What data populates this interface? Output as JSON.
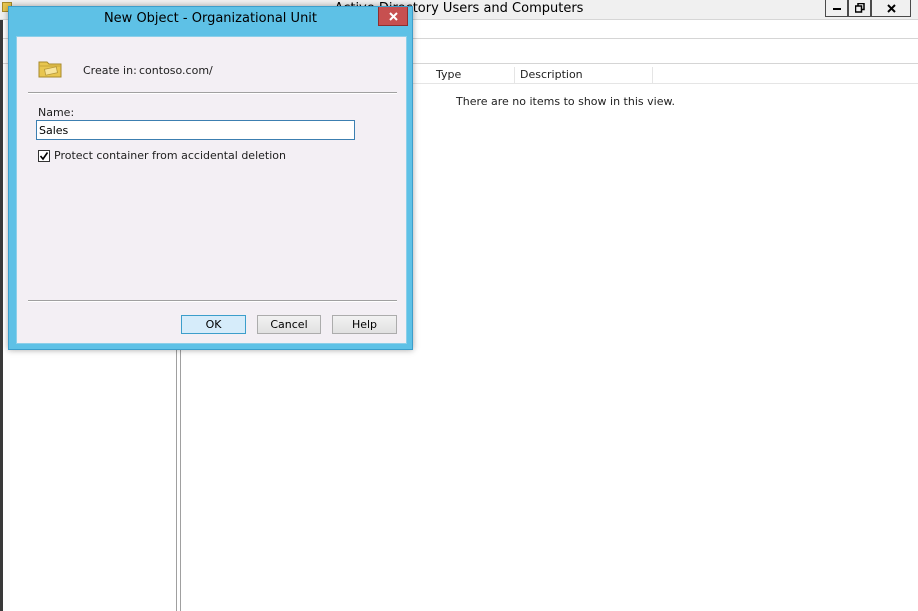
{
  "main_window": {
    "title": "Active Directory Users and Computers",
    "list": {
      "columns": [
        "Type",
        "Description"
      ],
      "empty_message": "There are no items to show in this view."
    },
    "controls": {
      "minimize": "–",
      "restore": "⧉",
      "close": "x"
    }
  },
  "dialog": {
    "title": "New Object - Organizational Unit",
    "close_glyph": "x",
    "create_in_label": "Create in:",
    "create_in_value": "contoso.com/",
    "name_label": "Name:",
    "name_value": "Sales",
    "protect_label": "Protect container from accidental deletion",
    "protect_checked": true,
    "buttons": {
      "ok": "OK",
      "cancel": "Cancel",
      "help": "Help"
    }
  },
  "colors": {
    "dialog_frame": "#5ec1e6",
    "dialog_body": "#f3eff4",
    "close_button": "#c75050"
  }
}
